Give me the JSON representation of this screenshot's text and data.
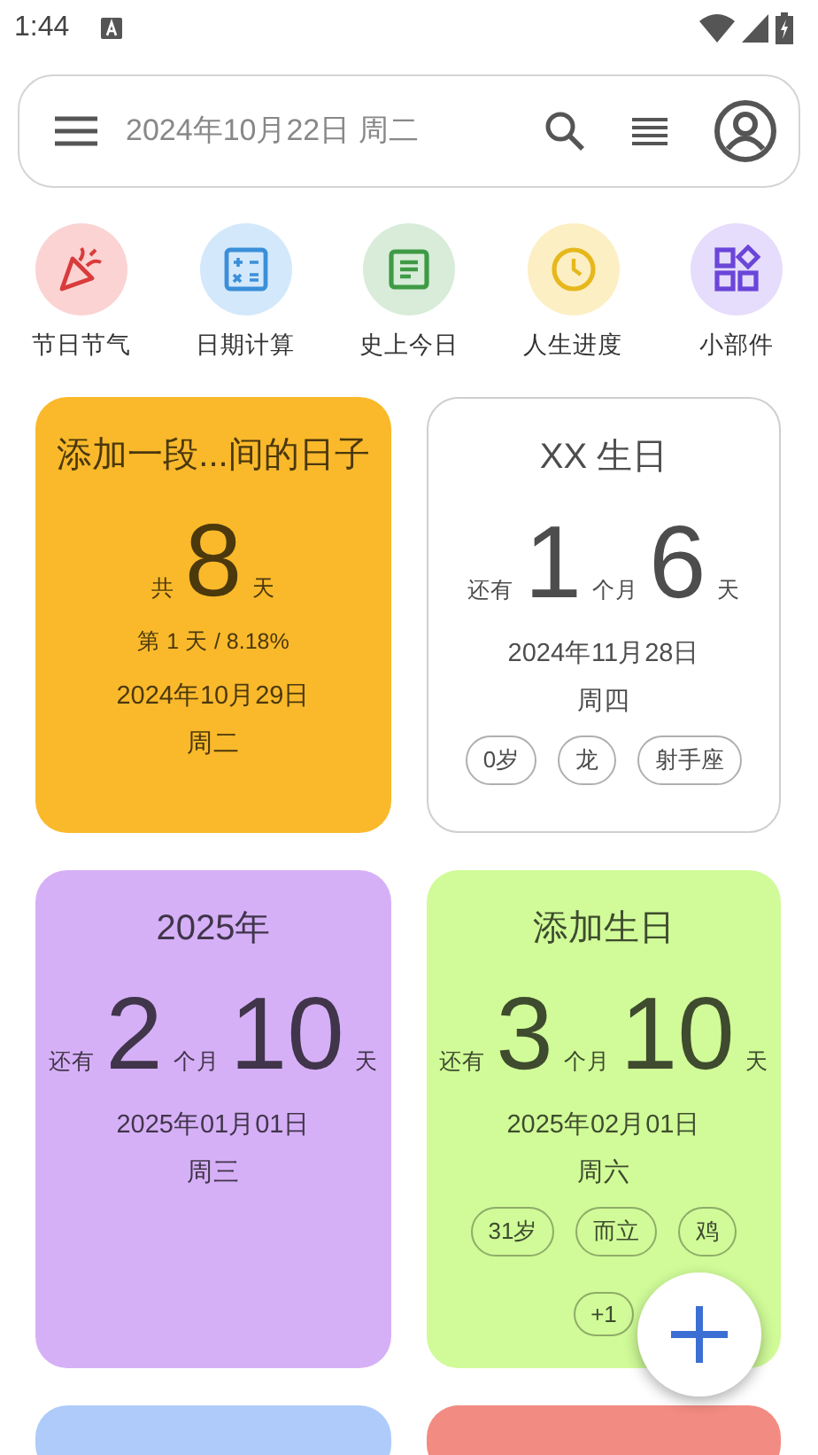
{
  "status_bar": {
    "time": "1:44"
  },
  "search": {
    "placeholder": "2024年10月22日 周二"
  },
  "shortcuts": [
    {
      "label": "节日节气",
      "kind": "party",
      "color": "#fbd3d3"
    },
    {
      "label": "日期计算",
      "kind": "calc",
      "color": "#d3e8fb"
    },
    {
      "label": "史上今日",
      "kind": "note",
      "color": "#d8ecd9"
    },
    {
      "label": "人生进度",
      "kind": "clock",
      "color": "#fdefc4"
    },
    {
      "label": "小部件",
      "kind": "widgets",
      "color": "#e6dcfb"
    }
  ],
  "cards": [
    {
      "color": "#f9b92b",
      "title": "添加一段...间的日子",
      "count": [
        {
          "kind": "unit",
          "text": "共"
        },
        {
          "kind": "number",
          "text": "8"
        },
        {
          "kind": "unit",
          "text": "天"
        }
      ],
      "progress": "第 1 天 / 8.18%",
      "date": "2024年10月29日",
      "weekday": "周二"
    },
    {
      "color": "#ffffff",
      "title": "XX 生日",
      "count": [
        {
          "kind": "unit",
          "text": "还有"
        },
        {
          "kind": "number",
          "text": "1"
        },
        {
          "kind": "unit",
          "text": "个月"
        },
        {
          "kind": "number",
          "text": "6"
        },
        {
          "kind": "unit",
          "text": "天"
        }
      ],
      "date": "2024年11月28日",
      "weekday": "周四",
      "tags": [
        "0岁",
        "龙",
        "射手座"
      ]
    },
    {
      "color": "#d6b0f7",
      "title": "2025年",
      "count": [
        {
          "kind": "unit",
          "text": "还有"
        },
        {
          "kind": "number",
          "text": "2"
        },
        {
          "kind": "unit",
          "text": "个月"
        },
        {
          "kind": "number",
          "text": "10"
        },
        {
          "kind": "unit",
          "text": "天"
        }
      ],
      "date": "2025年01月01日",
      "weekday": "周三"
    },
    {
      "color": "#d0fb98",
      "title": "添加生日",
      "count": [
        {
          "kind": "unit",
          "text": "还有"
        },
        {
          "kind": "number",
          "text": "3"
        },
        {
          "kind": "unit",
          "text": "个月"
        },
        {
          "kind": "number",
          "text": "10"
        },
        {
          "kind": "unit",
          "text": "天"
        }
      ],
      "date": "2025年02月01日",
      "weekday": "周六",
      "tags": [
        "31岁",
        "而立",
        "鸡",
        "+1"
      ]
    },
    {
      "color": "#aecbfa"
    },
    {
      "color": "#f28b82"
    }
  ]
}
